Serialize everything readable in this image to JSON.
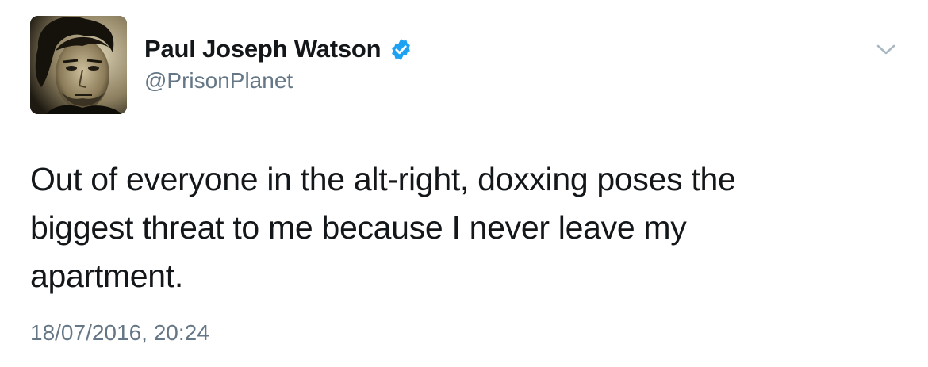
{
  "tweet": {
    "author": {
      "display_name": "Paul Joseph Watson",
      "handle": "@PrisonPlanet",
      "verified": true,
      "verified_color": "#1da1f2"
    },
    "text": "Out of everyone in the alt-right, doxxing poses the biggest threat to me because I never leave my apartment.",
    "timestamp": "18/07/2016, 20:24",
    "menu_icon": "chevron-down-icon",
    "avatar_icon": "avatar-photo"
  }
}
